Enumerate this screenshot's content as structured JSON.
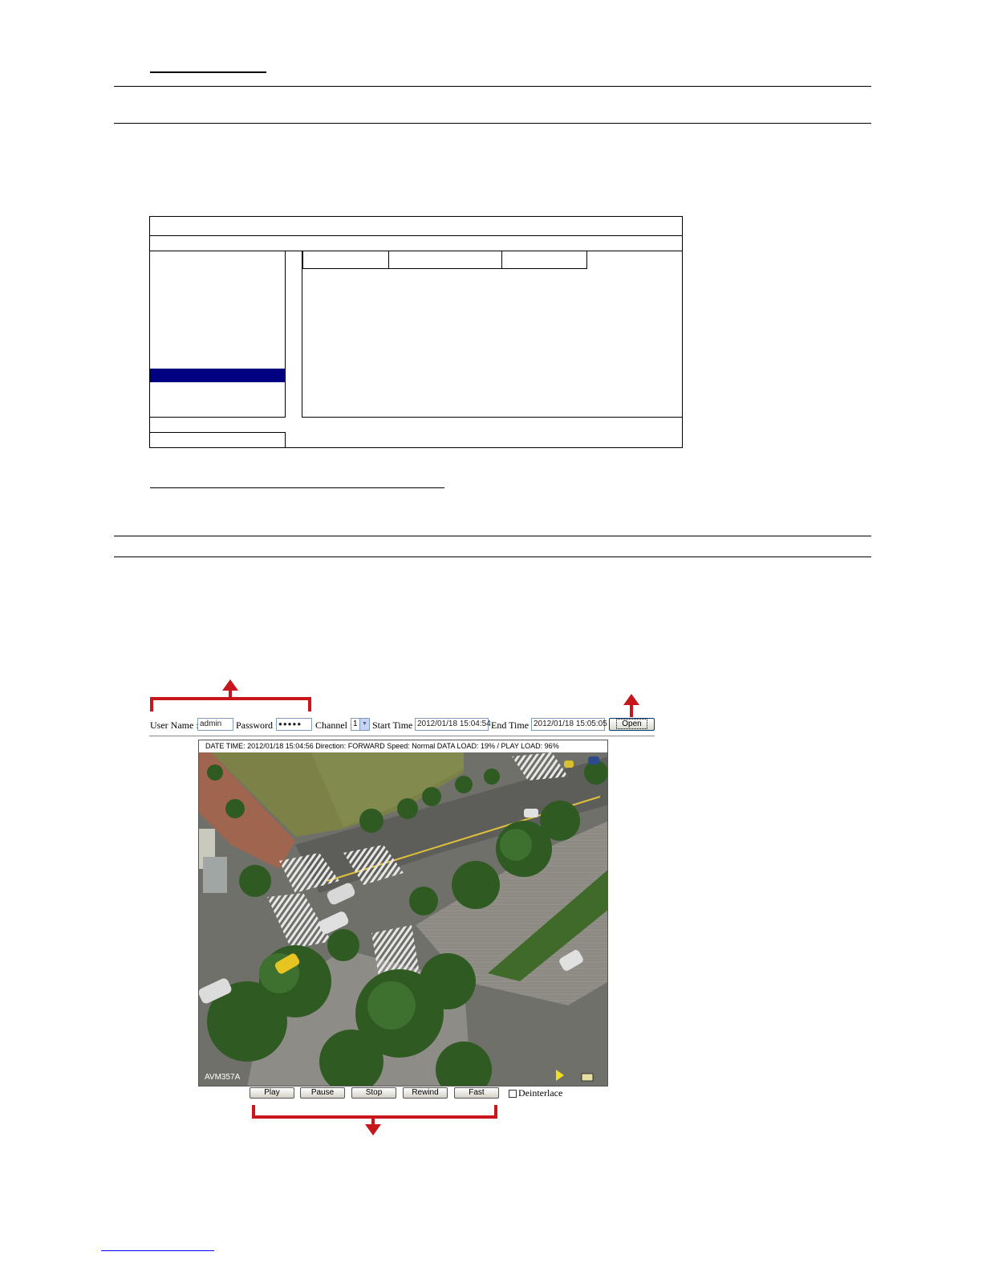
{
  "player": {
    "toolbar": {
      "username_label": "User Name :",
      "username_value": "admin",
      "password_label": "Password :",
      "password_value": "●●●●●",
      "channel_label": "Channel :",
      "channel_value": "1",
      "start_label": "Start Time :",
      "start_value": "2012/01/18 15:04:54",
      "end_label": "End Time :",
      "end_value": "2012/01/18 15:05:05",
      "open_label": "Open"
    },
    "status_text": "DATE TIME: 2012/01/18 15:04:56   Direction: FORWARD  Speed: Normal  DATA LOAD: 19% / PLAY LOAD: 96%",
    "camera_name": "AVM357A",
    "controls": {
      "play": "Play",
      "pause": "Pause",
      "stop": "Stop",
      "rewind": "Rewind",
      "fast": "Fast",
      "deinterlace": "Deinterlace"
    }
  },
  "colors": {
    "selection": "#000080",
    "callout": "#c8161d",
    "link": "#0000ff"
  }
}
